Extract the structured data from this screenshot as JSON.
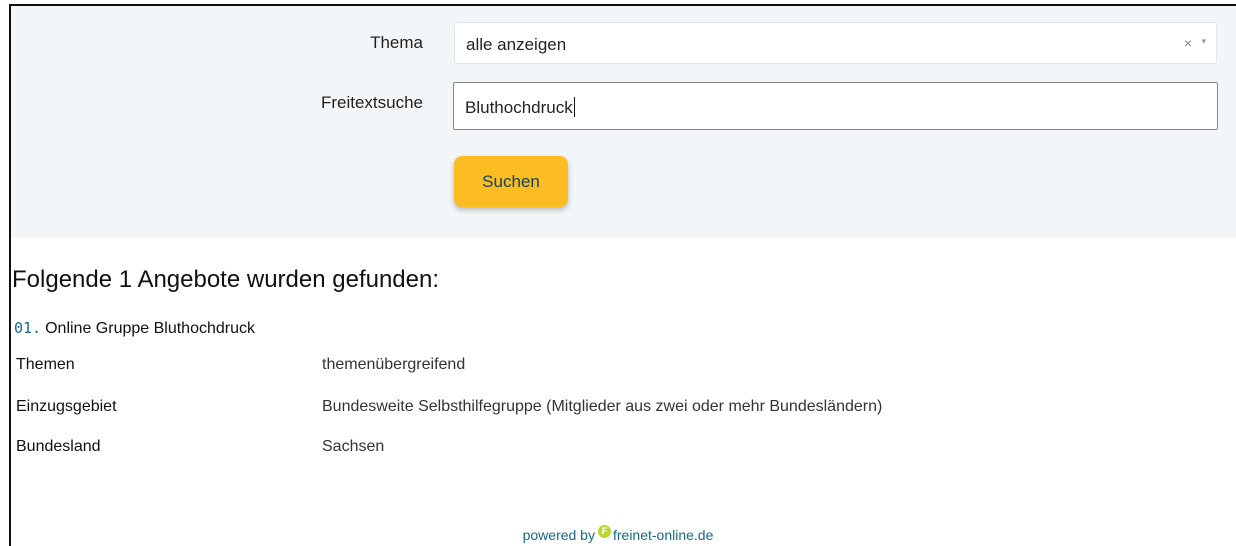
{
  "search_form": {
    "topic_label": "Thema",
    "topic_value": "alle anzeigen",
    "topic_clear_icon": "×",
    "topic_arrow_icon": "▾",
    "freetext_label": "Freitextsuche",
    "freetext_value": "Bluthochdruck",
    "search_button_label": "Suchen",
    "button_color": "#fbbd22"
  },
  "results": {
    "heading": "Folgende 1 Angebote wurden gefunden:",
    "items": [
      {
        "number": "01.",
        "title": "Online Gruppe Bluthochdruck",
        "fields": [
          {
            "label": "Themen",
            "value": "themenübergreifend"
          },
          {
            "label": "Einzugsgebiet",
            "value": "Bundesweite Selbsthilfegruppe (Mitglieder aus zwei oder mehr Bundesländern)"
          },
          {
            "label": "Bundesland",
            "value": "Sachsen"
          }
        ]
      }
    ]
  },
  "footer": {
    "prefix": "powered by",
    "logo_icon": "freinet-logo-icon",
    "logo_letter": "F",
    "site": "freinet-online.de",
    "accent_color": "#176b86"
  }
}
